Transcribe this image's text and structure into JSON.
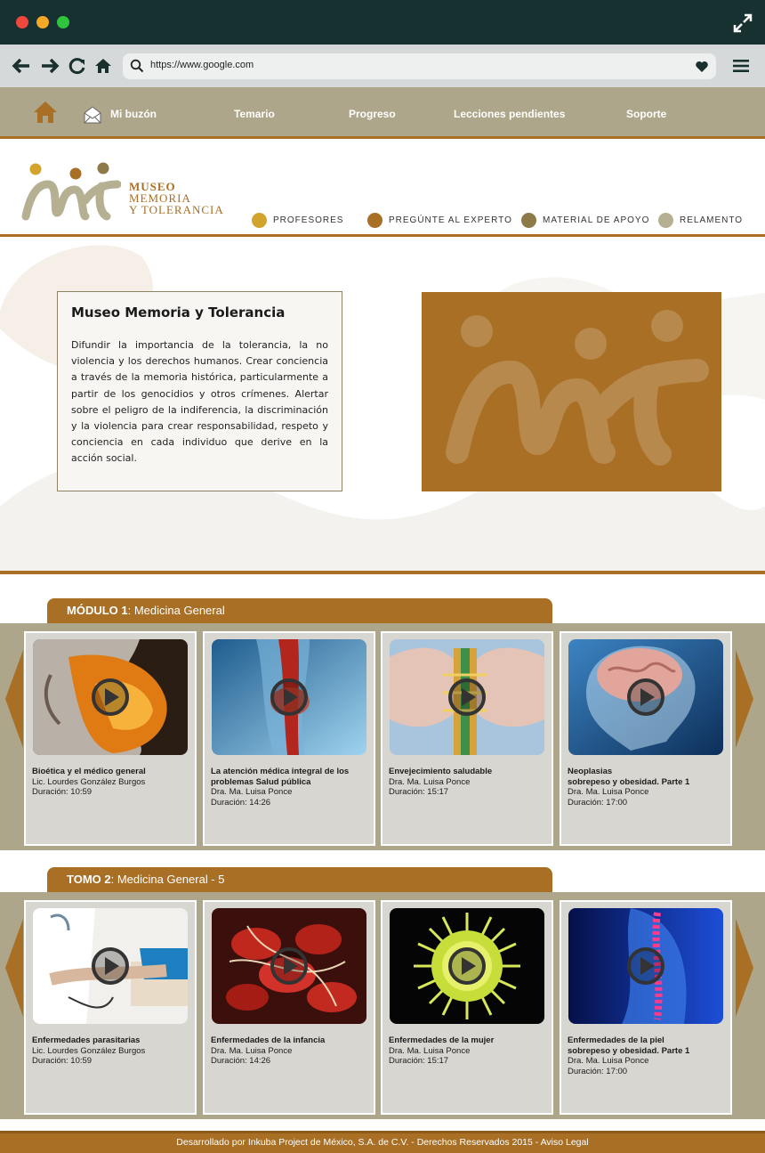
{
  "browser": {
    "url": "https://www.google.com"
  },
  "nav": {
    "mailbox": "Mi buzón",
    "topics": "Temario",
    "progress": "Progreso",
    "pending": "Lecciones pendientes",
    "support": "Soporte"
  },
  "logo": {
    "line1": "MUSEO",
    "line2": "MEMORIA",
    "line3": "Y TOLERANCIA"
  },
  "header_links": [
    {
      "label": "PROFESORES",
      "color": "#d2a42c"
    },
    {
      "label": "PREGÚNTE AL EXPERTO",
      "color": "#a86f25"
    },
    {
      "label": "MATERIAL DE APOYO",
      "color": "#8e7a48"
    },
    {
      "label": "RELAMENTO",
      "color": "#b5b092"
    }
  ],
  "hero": {
    "title": "Museo Memoria y Tolerancia",
    "body": "Difundir la importancia de la tolerancia, la no violencia y los derechos humanos. Crear conciencia a través de la memoria histórica, particularmente a partir de los genocidios y otros crímenes. Alertar sobre el peligro de la indiferencia, la discriminación y la violencia para crear responsabilidad, respeto y conciencia en cada individuo que derive en la acción social."
  },
  "module1": {
    "label": "MÓDULO 1",
    "title": ": Medicina General",
    "cards": [
      {
        "title": "Bioética y el médico general",
        "author": "Lic. Lourdes González Burgos",
        "duration": "Duración: 10:59"
      },
      {
        "title": "La atención médica integral de los problemas Salud pública",
        "author": "Dra.  Ma. Luisa Ponce",
        "duration": "Duración: 14:26"
      },
      {
        "title": "Envejecimiento saludable",
        "author": "Dra.  Ma. Luisa Ponce",
        "duration": "Duración: 15:17"
      },
      {
        "title": "Neoplasias",
        "subtitle": "sobrepeso y obesidad. Parte 1",
        "author": "Dra.  Ma. Luisa Ponce",
        "duration": "Duración: 17:00"
      }
    ]
  },
  "module2": {
    "label": "TOMO 2",
    "title": ": Medicina General - 5",
    "cards": [
      {
        "title": "Enfermedades parasitarias",
        "author": "Lic. Lourdes González Burgos",
        "duration": "Duración: 10:59"
      },
      {
        "title": "Enfermedades de la infancia",
        "author": "Dra.  Ma. Luisa Ponce",
        "duration": "Duración: 14:26"
      },
      {
        "title": "Enfermedades de la mujer",
        "author": "Dra.  Ma. Luisa Ponce",
        "duration": "Duración: 15:17"
      },
      {
        "title": "Enfermedades de la piel",
        "subtitle": "sobrepeso y obesidad. Parte 1",
        "author": "Dra.  Ma. Luisa Ponce",
        "duration": "Duración: 17:00"
      }
    ]
  },
  "footer": {
    "text": "Desarrollado por Inkuba Project de México, S.A. de C.V. - Derechos Reservados 2015 - Aviso Legal"
  },
  "colors": {
    "brand": "#a86f25",
    "nav_bg": "#aea68a",
    "titlebar": "#16312f"
  }
}
